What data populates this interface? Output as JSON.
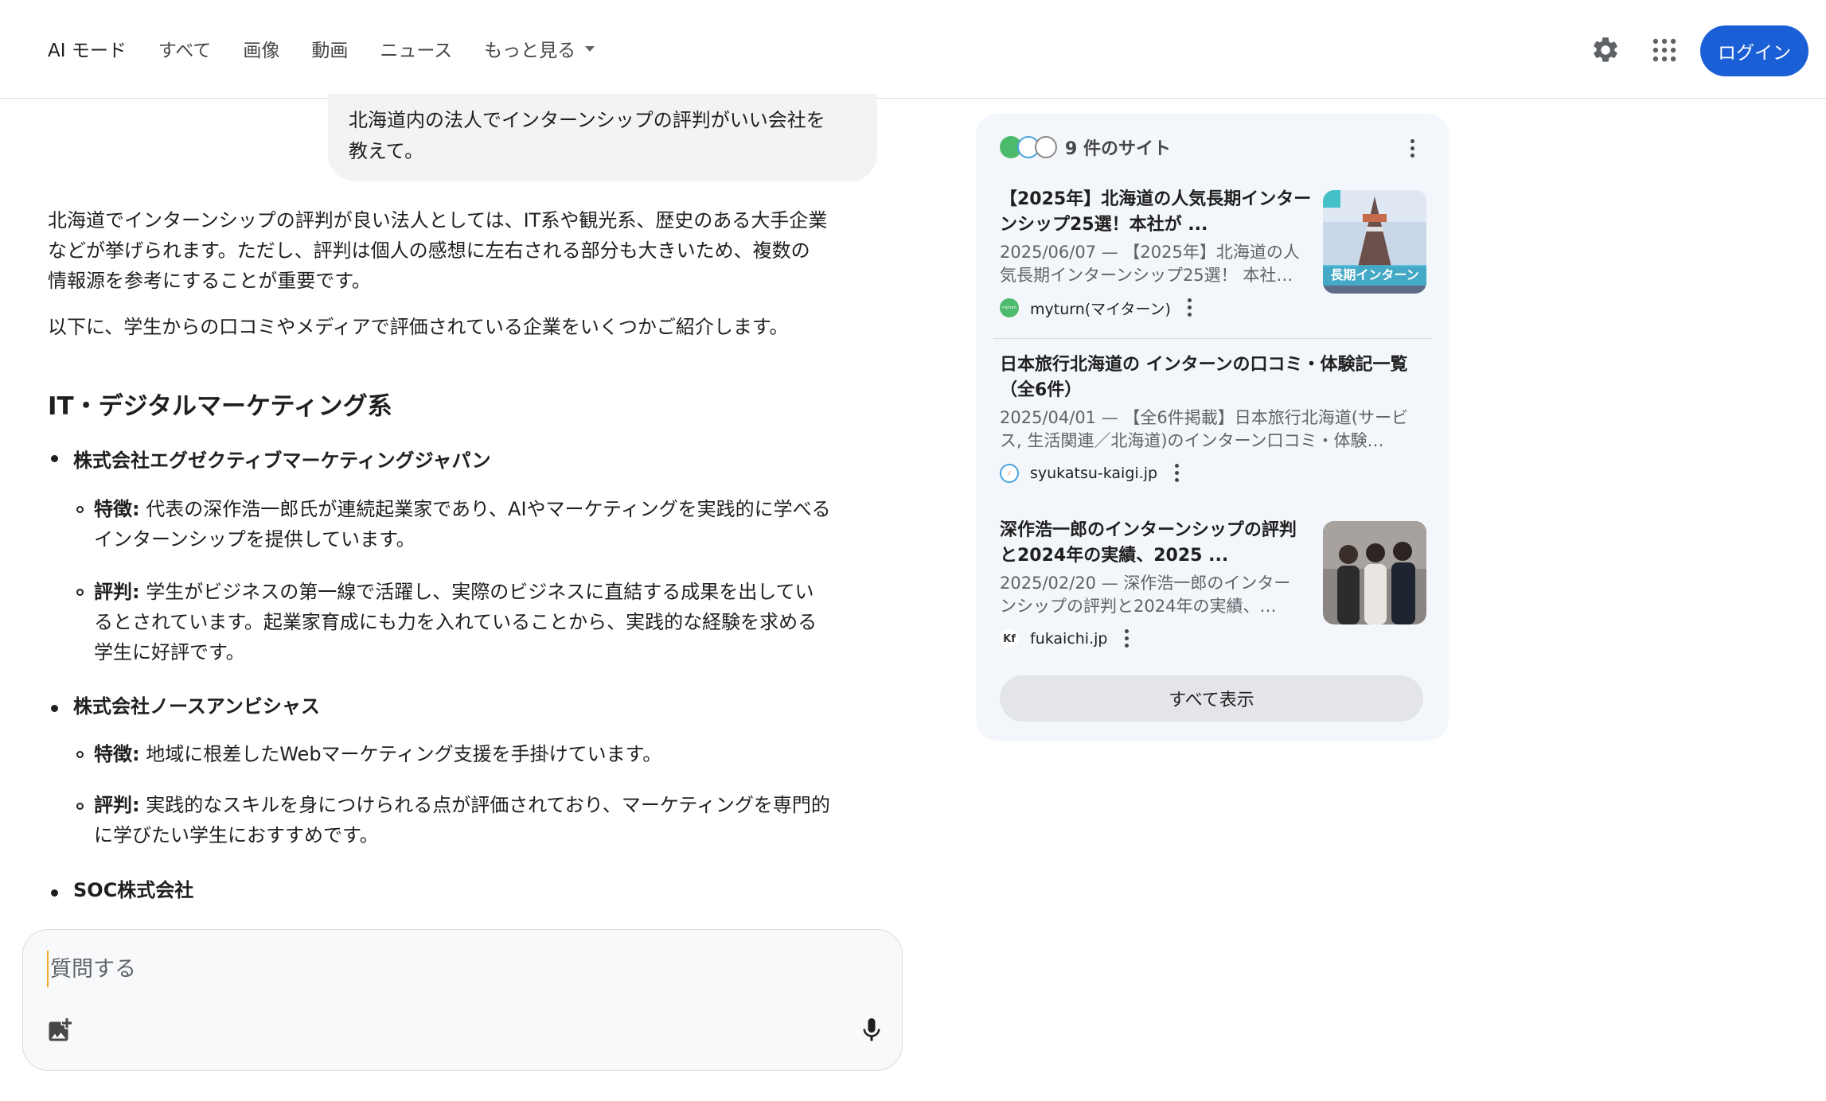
{
  "header": {
    "tabs": [
      {
        "label": "AI モード",
        "active": true
      },
      {
        "label": "すべて"
      },
      {
        "label": "画像"
      },
      {
        "label": "動画"
      },
      {
        "label": "ニュース"
      },
      {
        "label": "もっと見る"
      }
    ],
    "login_label": "ログイン",
    "icons": [
      "settings-icon",
      "apps-grid-icon"
    ]
  },
  "conversation": {
    "user_query_line1": "北海道内の法人でインターンシップの評判がいい会社を",
    "user_query_line2": "教えて。",
    "intro_lines": [
      "北海道でインターンシップの評判が良い法人としては、IT系や観光系、歴史のある大手企業",
      "などが挙げられます。ただし、評判は個人の感想に左右される部分も大きいため、複数の",
      "情報源を参考にすることが重要です。"
    ],
    "intro2": "以下に、学生からの口コミやメディアで評価されている企業をいくつかご紹介します。",
    "section_heading": "IT・デジタルマーケティング系",
    "companies": [
      {
        "name": "株式会社エグゼクティブマーケティングジャパン",
        "feature_label": "特徴:",
        "feature_lines": [
          " 代表の深作浩一郎氏が連続起業家であり、AIやマーケティングを実践的に学べる",
          "インターンシップを提供しています。"
        ],
        "review_label": "評判:",
        "review_lines": [
          " 学生がビジネスの第一線で活躍し、実際のビジネスに直結する成果を出してい",
          "るとされています。起業家育成にも力を入れていることから、実践的な経験を求める",
          "学生に好評です。"
        ]
      },
      {
        "name": "株式会社ノースアンビシャス",
        "feature_label": "特徴:",
        "feature_lines": [
          " 地域に根差したWebマーケティング支援を手掛けています。"
        ],
        "review_label": "評判:",
        "review_lines": [
          " 実践的なスキルを身につけられる点が評価されており、マーケティングを専門的",
          "に学びたい学生におすすめです。"
        ]
      },
      {
        "name": "SOC株式会社"
      }
    ]
  },
  "input": {
    "placeholder": "質問する",
    "icons": [
      "add-image-icon",
      "mic-icon"
    ]
  },
  "sources": {
    "count_label": "9 件のサイト",
    "items": [
      {
        "title_lines": [
          "【2025年】北海道の人気長期インター",
          "ンシップ25選！本社が ..."
        ],
        "snippet_lines": [
          "2025/06/07 — 【2025年】北海道の人",
          "気長期インターンシップ25選！ 本社…"
        ],
        "site": "myturn(マイターン)",
        "favicon_text": "myturn",
        "thumb_text": "長期インターン"
      },
      {
        "title_lines": [
          "日本旅行北海道の インターンの口コミ・体験記一覧",
          "（全6件）"
        ],
        "snippet_lines": [
          "2025/04/01 — 【全6件掲載】日本旅行北海道(サービ",
          "ス, 生活関連／北海道)のインターン口コミ・体験…"
        ],
        "site": "syukatsu-kaigi.jp"
      },
      {
        "title_lines": [
          "深作浩一郎のインターンシップの評判",
          "と2024年の実績、2025 ..."
        ],
        "snippet_lines": [
          "2025/02/20 — 深作浩一郎のインター",
          "ンシップの評判と2024年の実績、…"
        ],
        "site": "fukaichi.jp",
        "favicon_text": "Kf"
      }
    ],
    "show_all_label": "すべて表示"
  },
  "colors": {
    "accent": "#1a5fd6",
    "panel_bg": "#f3f6fb",
    "myturn_green": "#4cbb6c"
  }
}
